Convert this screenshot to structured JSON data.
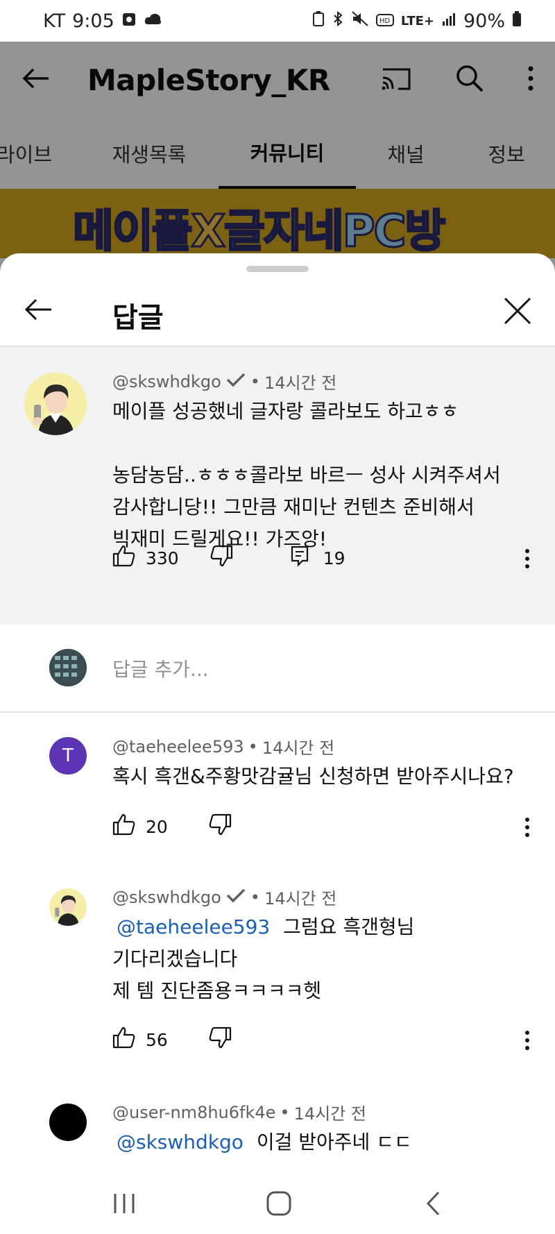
{
  "status_bar": {
    "carrier": "KT",
    "time": "9:05",
    "network": "LTE+",
    "battery": "90%"
  },
  "app_bar": {
    "title": "MapleStory_KR"
  },
  "tabs": [
    {
      "label": "라이브",
      "active": false
    },
    {
      "label": "재생목록",
      "active": false
    },
    {
      "label": "커뮤니티",
      "active": true
    },
    {
      "label": "채널",
      "active": false
    },
    {
      "label": "정보",
      "active": false
    }
  ],
  "banner": {
    "text_main": "메이플X글자네",
    "text_pc": "PC방"
  },
  "sheet": {
    "title": "답글"
  },
  "parent_comment": {
    "author": "@skswhdkgo",
    "verified": true,
    "time": "14시간 전",
    "text": "메이플 성공했네 글자랑 콜라보도 하고ㅎㅎ\n\n농담농담..ㅎㅎㅎ콜라보 바르ㅡ 성사 시켜주셔서\n감사합니당!! 그만큼 재미난 컨텐츠 준비해서\n빅재미 드릴게요!! 가즈앙!",
    "likes": "330",
    "replies": "19"
  },
  "add_reply": {
    "placeholder": "답글 추가..."
  },
  "replies": [
    {
      "author": "@taeheelee593",
      "verified": false,
      "time": "14시간 전",
      "avatar_letter": "T",
      "mention": "",
      "text": "혹시 흑갠&주황맛감귤님 신청하면 받아주시나요?",
      "likes": "20"
    },
    {
      "author": "@skswhdkgo",
      "verified": true,
      "time": "14시간 전",
      "avatar_letter": "",
      "mention": "@taeheelee593",
      "text_first": "그럼요 흑갠형님",
      "text": "기다리겠습니다\n제 템 진단좀용ㅋㅋㅋㅋ헷",
      "likes": "56"
    },
    {
      "author": "@user-nm8hu6fk4e",
      "verified": false,
      "time": "14시간 전",
      "avatar_letter": "",
      "mention": "@skswhdkgo",
      "text_first": "이걸 받아주네 ㄷㄷ"
    }
  ],
  "colors": {
    "mention": "#1a5fb4",
    "reply_avatar_t": "#5c35b5",
    "banner": "#d8a820"
  }
}
